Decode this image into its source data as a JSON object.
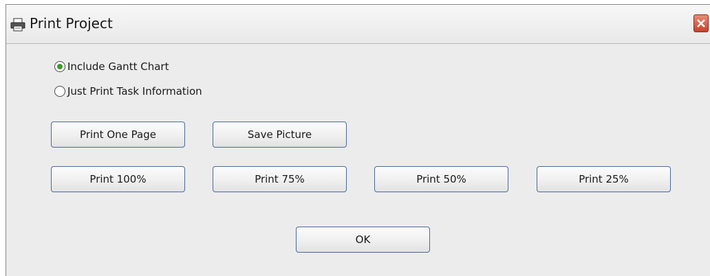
{
  "window": {
    "title": "Print Project",
    "title_icon": "printer-icon",
    "close_icon": "close-icon"
  },
  "options": [
    {
      "label": "Include Gantt Chart",
      "checked": true
    },
    {
      "label": "Just Print Task Information",
      "checked": false
    }
  ],
  "buttons": {
    "print_one_page": "Print One Page",
    "save_picture": "Save Picture",
    "print_100": "Print 100%",
    "print_75": "Print 75%",
    "print_50": "Print 50%",
    "print_25": "Print 25%",
    "ok": "OK"
  },
  "colors": {
    "close_button": "#c7432b",
    "radio_selected": "#3c9a2c",
    "button_border": "#4a6a9a"
  }
}
